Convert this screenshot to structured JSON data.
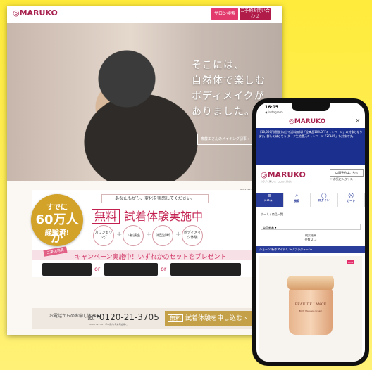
{
  "desktop": {
    "logo": "◎MARUKO",
    "header_buttons": {
      "sample": "サロン検索",
      "consult": "ご予約お問い合わせ"
    },
    "hero": {
      "copy_lines": [
        "そこには、",
        "自然体で楽しむ",
        "ボディメイクが",
        "ありました。"
      ],
      "link": "斎藤工さんのメイキング記事 ›",
      "credit": "※当社調べ"
    },
    "badge": {
      "line1": "すでに",
      "line2": "60万人が",
      "line3": "経験済!"
    },
    "tagline": "あなたもぜひ、変化を実感してください。",
    "main_heading": {
      "free": "無料",
      "text": "試着体験実施中"
    },
    "steps": [
      "カウンセリング",
      "下着講座",
      "体型診断",
      "ボディメイク体験"
    ],
    "campaign": {
      "tag": "ご来店特典",
      "heading": "キャンペーン実施中！いずれかのセットをプレゼント",
      "or_label": "or"
    },
    "footer": {
      "phone_label": "お電話からのお申し込み ▶",
      "phone_number": "☏ 0120-21-3705",
      "phone_hours": "10:00～21:00 / 年中無休(年末年始除く)",
      "apply_free": "無料",
      "apply_text": "試着体験を申し込む ›"
    }
  },
  "phone": {
    "status_time": "16:05",
    "status_app": "◀ Instagram",
    "tab_logo": "◎MARUKO",
    "tab_close": "×",
    "banner_text": "【10,000円(税抜)以上で送料無料】「全商品10%OFFキャンペーン」の対象となります。詳しくはこちら ダーク生地還元キャンペーン「2PLUS」も対象です。",
    "logo": "◎MARUKO",
    "logo_tagline": "カラダを美しく、ココロを豊かに",
    "btn_store": "店舗予約はこちら",
    "btn_fav": "♡ お気に入りリスト",
    "nav": [
      {
        "icon": "≡",
        "label": "メニュー"
      },
      {
        "icon": "⌕",
        "label": "検索"
      },
      {
        "icon": "◯",
        "label": "ログイン"
      },
      {
        "icon": "⛒",
        "label": "カート"
      }
    ],
    "breadcrumb": "ホーム / 商品一覧",
    "sort_label": "商品新着 ▾",
    "hits": "検索結果\n件数 213",
    "filter": "ショーツ 新作アイテム ≫  / ブラジャー ≫",
    "product": {
      "tag": "NEW",
      "brand": "PEAU DE LANCE",
      "sub": "Body Massage Cream"
    }
  }
}
